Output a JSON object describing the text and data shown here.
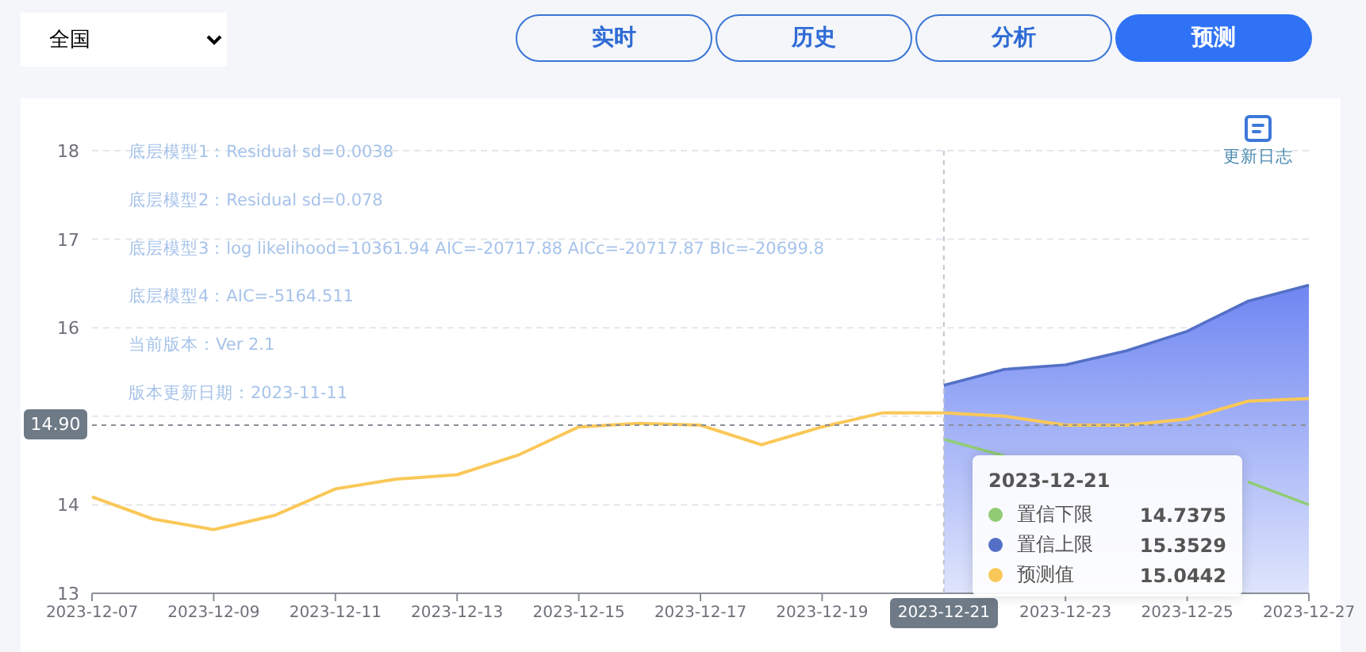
{
  "region_select": {
    "value": "全国"
  },
  "tabs": [
    {
      "label": "实时",
      "selected": false
    },
    {
      "label": "历史",
      "selected": false
    },
    {
      "label": "分析",
      "selected": false
    },
    {
      "label": "预测",
      "selected": true
    }
  ],
  "chart": {
    "update_log": "更新日志",
    "model_notes": [
      "底层模型1：Residual sd=0.0038",
      "底层模型2：Residual sd=0.078",
      "底层模型3：log likelihood=10361.94 AIC=-20717.88 AICc=-20717.87 BIc=-20699.8",
      "底层模型4：AIC=-5164.511",
      "当前版本：Ver 2.1",
      "版本更新日期：2023-11-11"
    ],
    "chart_data": {
      "type": "line",
      "x": [
        "2023-12-07",
        "2023-12-08",
        "2023-12-09",
        "2023-12-10",
        "2023-12-11",
        "2023-12-12",
        "2023-12-13",
        "2023-12-14",
        "2023-12-15",
        "2023-12-16",
        "2023-12-17",
        "2023-12-18",
        "2023-12-19",
        "2023-12-20",
        "2023-12-21",
        "2023-12-22",
        "2023-12-23",
        "2023-12-24",
        "2023-12-25",
        "2023-12-26",
        "2023-12-27"
      ],
      "xlim": [
        "2023-12-07",
        "2023-12-27"
      ],
      "ylim": [
        13,
        18
      ],
      "yticks": [
        13,
        14,
        16,
        17,
        18
      ],
      "grid": true,
      "xticks": [
        "2023-12-07",
        "2023-12-09",
        "2023-12-11",
        "2023-12-13",
        "2023-12-15",
        "2023-12-17",
        "2023-12-19",
        "2023-12-23",
        "2023-12-25",
        "2023-12-27"
      ],
      "ref_lines": [
        {
          "axis": "x",
          "value": "2023-12-21",
          "label": "2023-12-21"
        },
        {
          "axis": "y",
          "value": 14.9,
          "label": "14.90"
        }
      ],
      "series": [
        {
          "name": "置信下限",
          "color": "#91cc75",
          "values": [
            null,
            null,
            null,
            null,
            null,
            null,
            null,
            null,
            null,
            null,
            null,
            null,
            null,
            null,
            14.74,
            14.55,
            null,
            null,
            null,
            14.26,
            14.0
          ]
        },
        {
          "name": "置信上限",
          "color": "#5470c6",
          "values": [
            null,
            null,
            null,
            null,
            null,
            null,
            null,
            null,
            null,
            null,
            null,
            null,
            null,
            null,
            15.35,
            15.53,
            15.58,
            15.74,
            15.96,
            16.3,
            16.48
          ]
        },
        {
          "name": "预测值",
          "color": "#fac858",
          "values": [
            14.09,
            13.84,
            13.72,
            13.88,
            14.18,
            14.29,
            14.34,
            14.56,
            14.88,
            14.92,
            14.9,
            14.68,
            14.88,
            15.04,
            15.04,
            15.0,
            14.9,
            14.9,
            14.97,
            15.17,
            15.2
          ]
        }
      ]
    },
    "tooltip": {
      "title": "2023-12-21",
      "values": [
        "14.7375",
        "15.3529",
        "15.0442"
      ]
    }
  }
}
